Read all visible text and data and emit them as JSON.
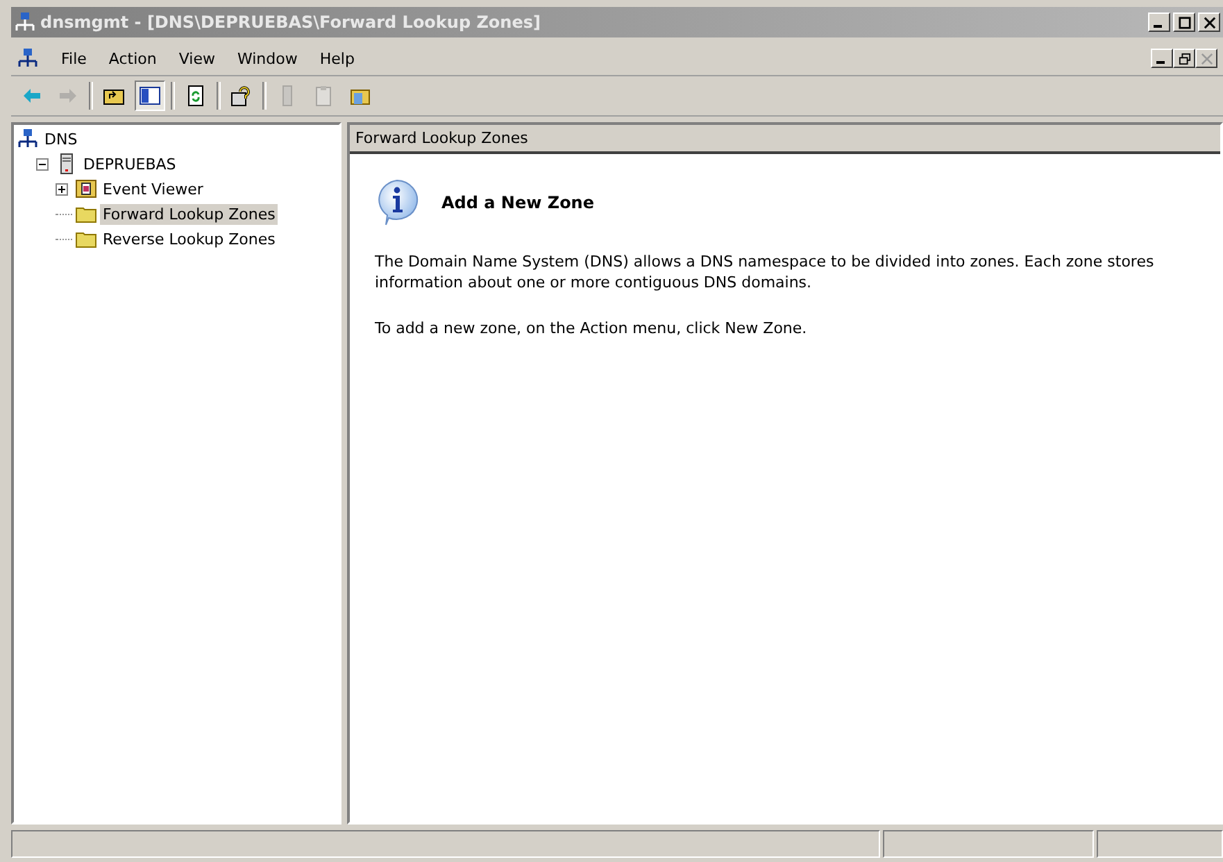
{
  "window": {
    "title": "dnsmgmt - [DNS\\DEPRUEBAS\\Forward Lookup Zones]"
  },
  "menu": [
    "File",
    "Action",
    "View",
    "Window",
    "Help"
  ],
  "toolbar": [
    {
      "kind": "back",
      "disabled": false,
      "pressed": false
    },
    {
      "kind": "forward",
      "disabled": true,
      "pressed": false
    },
    {
      "kind": "separator"
    },
    {
      "kind": "up",
      "disabled": false,
      "pressed": false
    },
    {
      "kind": "tree",
      "disabled": false,
      "pressed": true
    },
    {
      "kind": "separator"
    },
    {
      "kind": "refresh",
      "disabled": false,
      "pressed": false
    },
    {
      "kind": "separator"
    },
    {
      "kind": "help",
      "disabled": false,
      "pressed": false
    },
    {
      "kind": "separator"
    },
    {
      "kind": "server",
      "disabled": true,
      "pressed": false
    },
    {
      "kind": "clipboard",
      "disabled": true,
      "pressed": false
    },
    {
      "kind": "folder",
      "disabled": false,
      "pressed": false
    }
  ],
  "tree": [
    {
      "label": "DNS",
      "kind": "dns",
      "selected": false,
      "children": [
        {
          "label": "DEPRUEBAS",
          "kind": "server",
          "selected": false,
          "expanded": true,
          "children": [
            {
              "label": "Event Viewer",
              "kind": "viewer",
              "selected": false,
              "expanded": false
            },
            {
              "label": "Forward Lookup Zones",
              "kind": "folder",
              "selected": true
            },
            {
              "label": "Reverse Lookup Zones",
              "kind": "folder",
              "selected": false
            }
          ]
        }
      ]
    }
  ],
  "details": {
    "header": "Forward Lookup Zones",
    "heading": "Add a New Zone",
    "paragraphs": [
      "The Domain Name System (DNS) allows a DNS namespace to be divided into zones. Each zone stores information about one or more contiguous DNS domains.",
      "To add a new zone, on the Action menu, click New Zone."
    ]
  }
}
